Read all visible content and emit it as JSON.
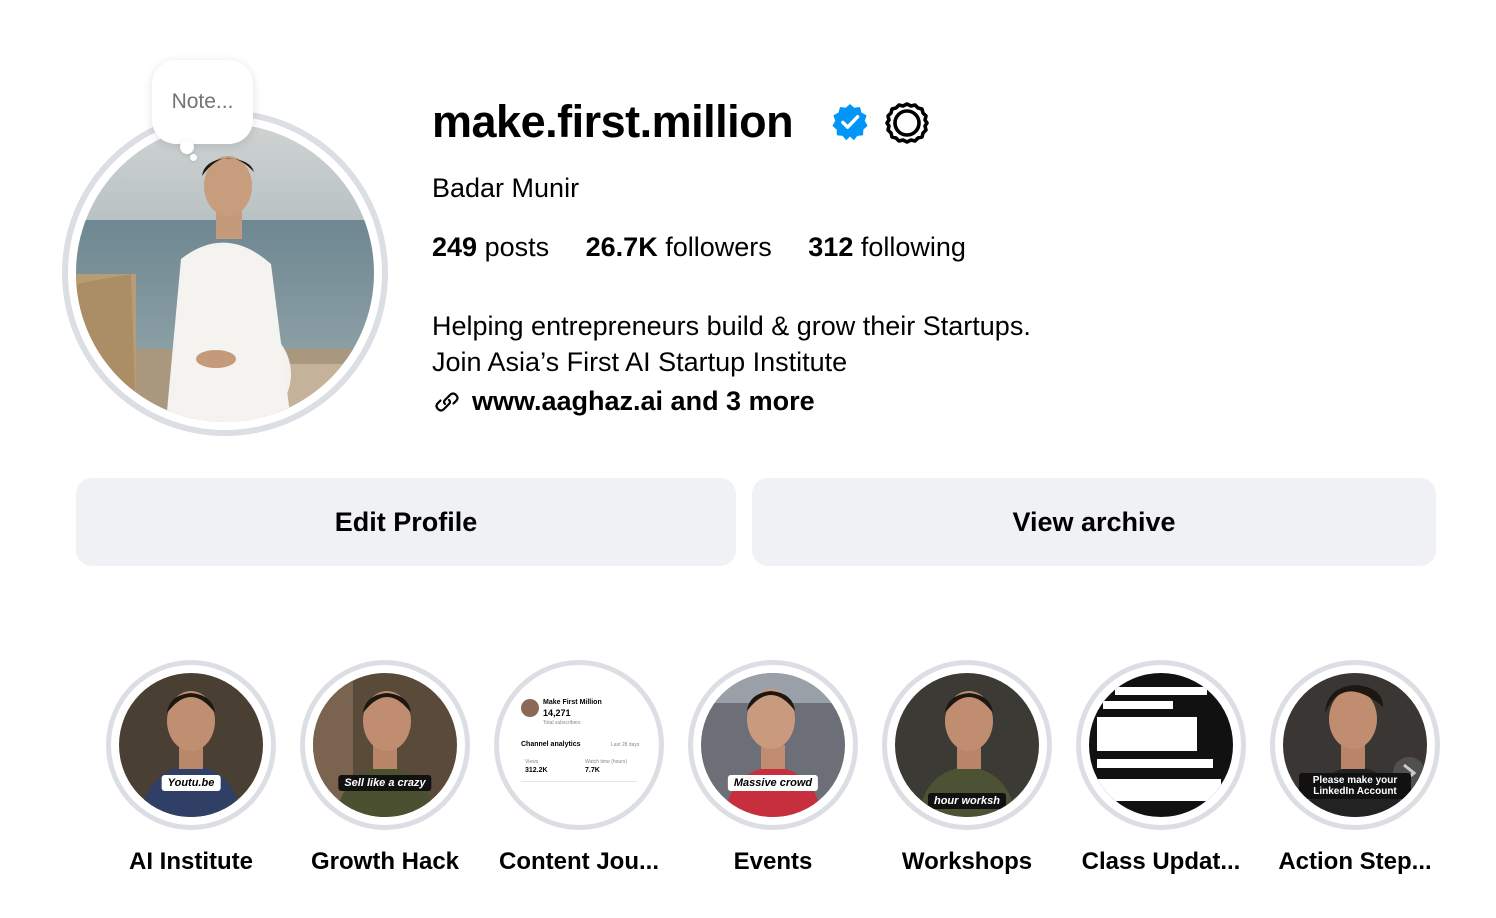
{
  "note": {
    "placeholder": "Note..."
  },
  "profile": {
    "username": "make.first.million",
    "full_name": "Badar Munir",
    "verified": true
  },
  "stats": {
    "posts_count": "249",
    "posts_label": "posts",
    "followers_count": "26.7K",
    "followers_label": "followers",
    "following_count": "312",
    "following_label": "following"
  },
  "bio": {
    "line1": "Helping entrepreneurs build & grow their Startups.",
    "line2": "Join Asia’s First AI Startup Institute",
    "link_text": "www.aaghaz.ai and 3 more"
  },
  "buttons": {
    "edit_profile": "Edit Profile",
    "view_archive": "View archive"
  },
  "highlights": [
    {
      "label": "AI Institute",
      "caption": "Youtu.be"
    },
    {
      "label": "Growth Hack",
      "caption": "Sell like a crazy"
    },
    {
      "label": "Content Jou...",
      "caption": ""
    },
    {
      "label": "Events",
      "caption": "Massive crowd"
    },
    {
      "label": "Workshops",
      "caption": "hour worksh"
    },
    {
      "label": "Class Updat...",
      "caption": ""
    },
    {
      "label": "Action Step...",
      "caption": "Please make your LinkedIn Account"
    }
  ],
  "highlight_screen": {
    "channel_name": "Make First Million",
    "subscribers": "14,271",
    "subscribers_label": "Total subscribers",
    "section": "Channel analytics",
    "period": "Last 28 days",
    "views_label": "Views",
    "views": "312.2K",
    "watch_label": "Watch time (hours)",
    "watch": "7.7K"
  },
  "colors": {
    "verified_blue": "#0095f6",
    "button_bg": "#eff1f5",
    "ring": "#dbdee3"
  }
}
